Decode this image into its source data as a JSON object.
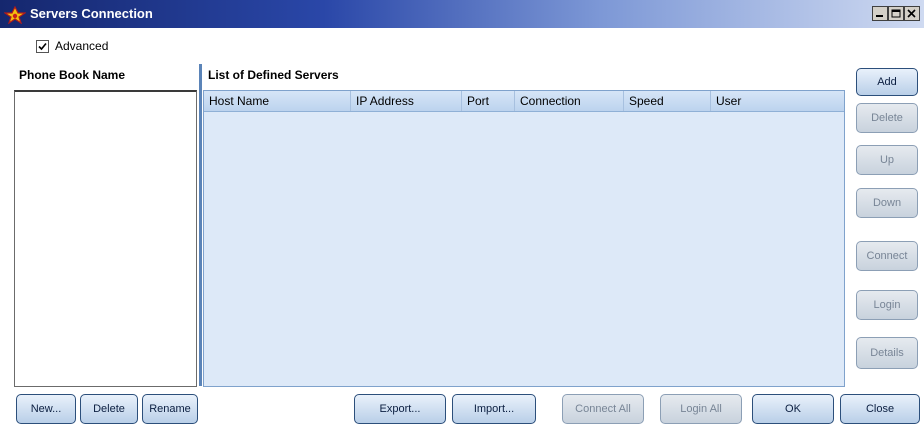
{
  "window": {
    "title": "Servers Connection",
    "controls": [
      "minimize",
      "maximize",
      "close"
    ]
  },
  "advanced": {
    "label": "Advanced",
    "checked": true
  },
  "phonebook": {
    "header": "Phone Book Name",
    "items": []
  },
  "servers": {
    "header": "List of Defined Servers",
    "columns": [
      "Host Name",
      "IP Address",
      "Port",
      "Connection",
      "Speed",
      "User"
    ],
    "rows": []
  },
  "side_buttons": {
    "add": "Add",
    "delete": "Delete",
    "up": "Up",
    "down": "Down",
    "connect": "Connect",
    "login": "Login",
    "details": "Details"
  },
  "bottom_buttons": {
    "new": "New...",
    "delete": "Delete",
    "rename": "Rename",
    "export": "Export...",
    "import": "Import...",
    "connect_all": "Connect All",
    "login_all": "Login All",
    "ok": "OK",
    "close": "Close"
  },
  "colors": {
    "titlebar_start": "#15276e",
    "titlebar_end": "#cfdaf1",
    "table_bg": "#dde9f8",
    "accent": "#5b84b8"
  },
  "icons": {
    "app": "app-logo-icon",
    "check": "check-icon"
  }
}
